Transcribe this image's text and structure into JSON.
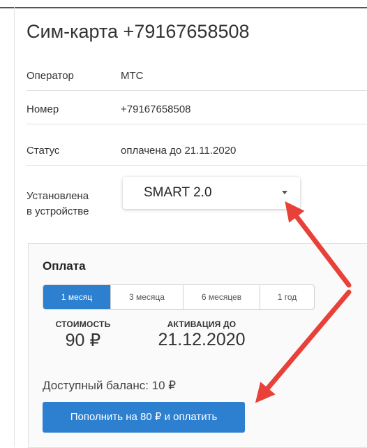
{
  "title": "Сим-карта +79167658508",
  "details": [
    {
      "label": "Оператор",
      "value": "МТС"
    },
    {
      "label": "Номер",
      "value": "+79167658508"
    },
    {
      "label": "Статус",
      "value": "оплачена до 21.11.2020"
    }
  ],
  "installed": {
    "label_line1": "Установлена",
    "label_line2": "в устройстве",
    "selected": "SMART 2.0"
  },
  "payment": {
    "title": "Оплата",
    "tabs": [
      {
        "label": "1 месяц",
        "active": true
      },
      {
        "label": "3 месяца",
        "active": false
      },
      {
        "label": "6 месяцев",
        "active": false
      },
      {
        "label": "1 год",
        "active": false
      }
    ],
    "cost_label": "СТОИМОСТЬ",
    "cost_value": "90 ₽",
    "activation_label": "АКТИВАЦИЯ ДО",
    "activation_value": "21.12.2020",
    "balance_text": "Доступный баланс: 10 ₽",
    "button_label": "Пополнить на 80 ₽ и оплатить"
  },
  "colors": {
    "accent": "#2d7fd0",
    "annotation_arrow": "#e8413a"
  }
}
